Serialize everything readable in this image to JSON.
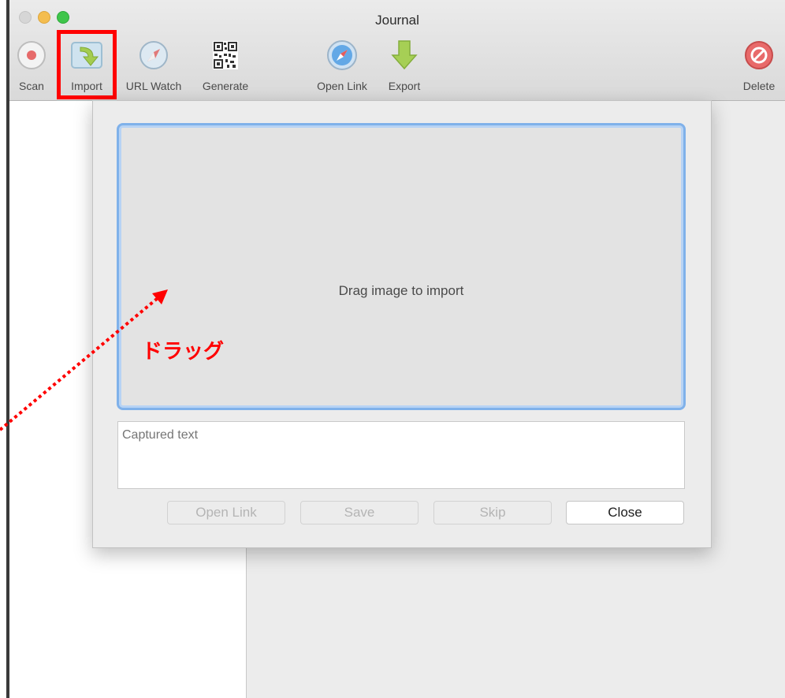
{
  "window": {
    "title": "Journal"
  },
  "toolbar": {
    "items": [
      {
        "label": "Scan",
        "icon": "scan-icon"
      },
      {
        "label": "Import",
        "icon": "import-icon"
      },
      {
        "label": "URL Watch",
        "icon": "url-watch-icon"
      },
      {
        "label": "Generate",
        "icon": "qr-code-icon"
      },
      {
        "label": "Open Link",
        "icon": "safari-compass-icon"
      },
      {
        "label": "Export",
        "icon": "export-arrow-icon"
      },
      {
        "label": "Delete",
        "icon": "delete-icon"
      }
    ]
  },
  "sheet": {
    "drop_prompt": "Drag image to import",
    "captured_placeholder": "Captured text",
    "buttons": {
      "open_link": "Open Link",
      "save": "Save",
      "skip": "Skip",
      "close": "Close"
    }
  },
  "annotation": {
    "label": "ドラッグ",
    "color": "#ff0000"
  },
  "colors": {
    "highlight": "#ff0000",
    "dropzone_border": "#7fb1ea"
  }
}
